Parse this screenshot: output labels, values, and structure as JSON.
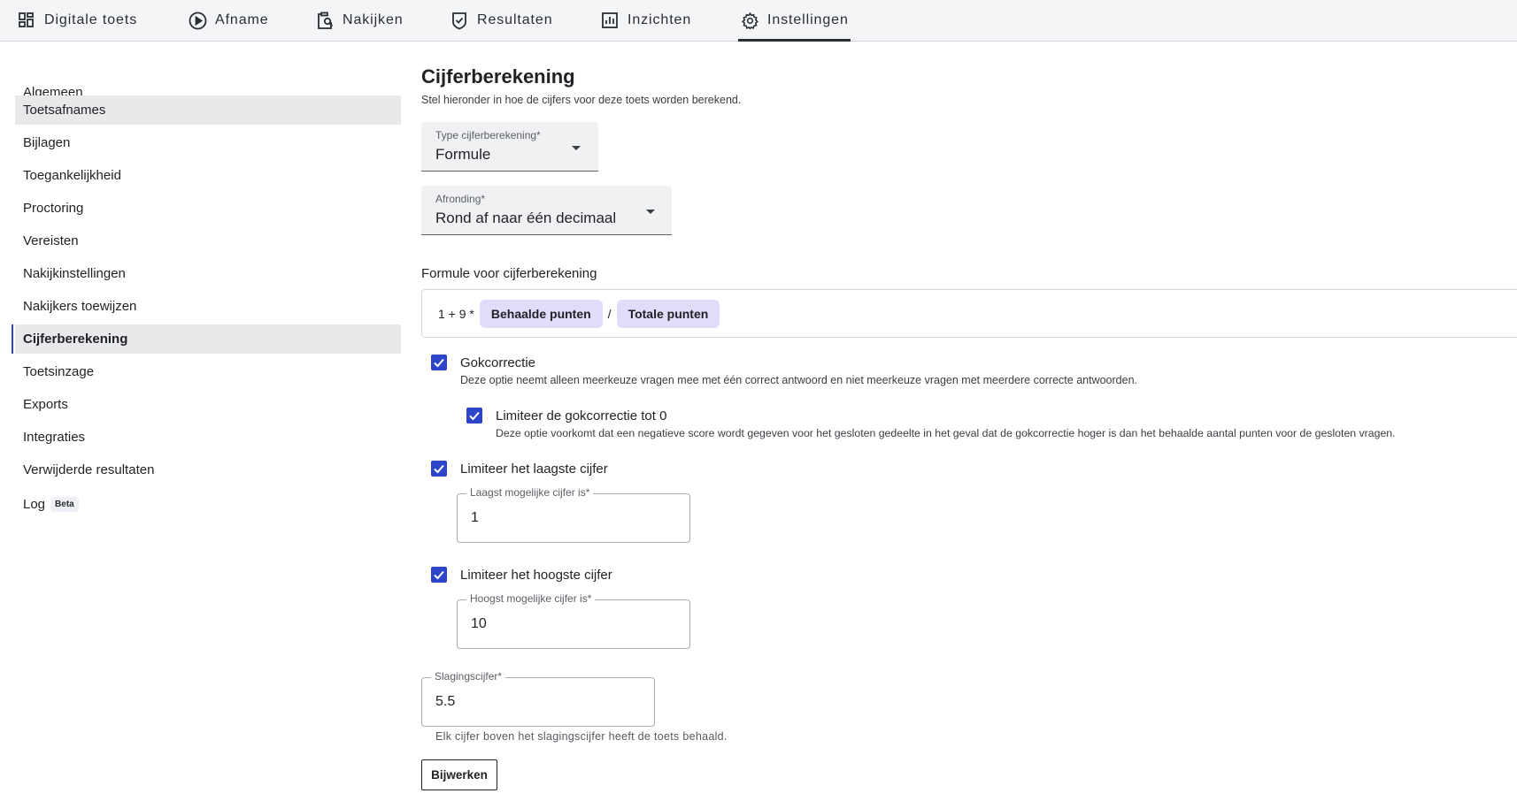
{
  "topnav": {
    "tabs": [
      {
        "label": "Digitale toets",
        "icon": "grid-icon"
      },
      {
        "label": "Afname",
        "icon": "play-circle-icon"
      },
      {
        "label": "Nakijken",
        "icon": "clipboard-search-icon"
      },
      {
        "label": "Resultaten",
        "icon": "shield-check-icon"
      },
      {
        "label": "Inzichten",
        "icon": "bar-chart-icon"
      },
      {
        "label": "Instellingen",
        "icon": "gear-icon",
        "active": true
      }
    ]
  },
  "sidebar": {
    "items": [
      {
        "label": "Algemeen"
      },
      {
        "label": "Toetsafnames"
      },
      {
        "label": "Bijlagen"
      },
      {
        "label": "Toegankelijkheid"
      },
      {
        "label": "Proctoring"
      },
      {
        "label": "Vereisten"
      },
      {
        "label": "Nakijkinstellingen"
      },
      {
        "label": "Nakijkers toewijzen"
      },
      {
        "label": "Cijferberekening"
      },
      {
        "label": "Toetsinzage"
      },
      {
        "label": "Exports"
      },
      {
        "label": "Integraties"
      },
      {
        "label": "Verwijderde resultaten"
      },
      {
        "label": "Log",
        "badge": "Beta"
      }
    ]
  },
  "main": {
    "title": "Cijferberekening",
    "subtitle": "Stel hieronder in hoe de cijfers voor deze toets worden berekend.",
    "type_select": {
      "label": "Type cijferberekening*",
      "value": "Formule"
    },
    "rounding_select": {
      "label": "Afronding*",
      "value": "Rond af naar één decimaal"
    },
    "formula": {
      "label": "Formule voor cijferberekening",
      "prefix": "1 + 9 *",
      "chip1": "Behaalde punten",
      "operator": "/",
      "chip2": "Totale punten"
    },
    "guess_correction": {
      "label": "Gokcorrectie",
      "description": "Deze optie neemt alleen meerkeuze vragen mee met één correct antwoord en niet meerkeuze vragen met meerdere correcte antwoorden.",
      "checked": true
    },
    "limit_guess": {
      "label": "Limiteer de gokcorrectie tot 0",
      "description": "Deze optie voorkomt dat een negatieve score wordt gegeven voor het gesloten gedeelte in het geval dat de gokcorrectie hoger is dan het behaalde aantal punten voor de gesloten vragen.",
      "checked": true
    },
    "limit_lowest": {
      "label": "Limiteer het laagste cijfer",
      "checked": true,
      "field_label": "Laagst mogelijke cijfer is*",
      "field_value": "1"
    },
    "limit_highest": {
      "label": "Limiteer het hoogste cijfer",
      "checked": true,
      "field_label": "Hoogst mogelijke cijfer is*",
      "field_value": "10"
    },
    "pass_grade": {
      "label": "Slagingscijfer*",
      "value": "5.5",
      "helper": "Elk cijfer boven het slagingscijfer heeft de toets behaald."
    },
    "update_button": "Bijwerken"
  },
  "colors": {
    "accent": "#2c45c9",
    "chip": "#e2dcfb",
    "nav_bg": "#f4f5f7",
    "selected_bg": "#e8e9eb"
  }
}
